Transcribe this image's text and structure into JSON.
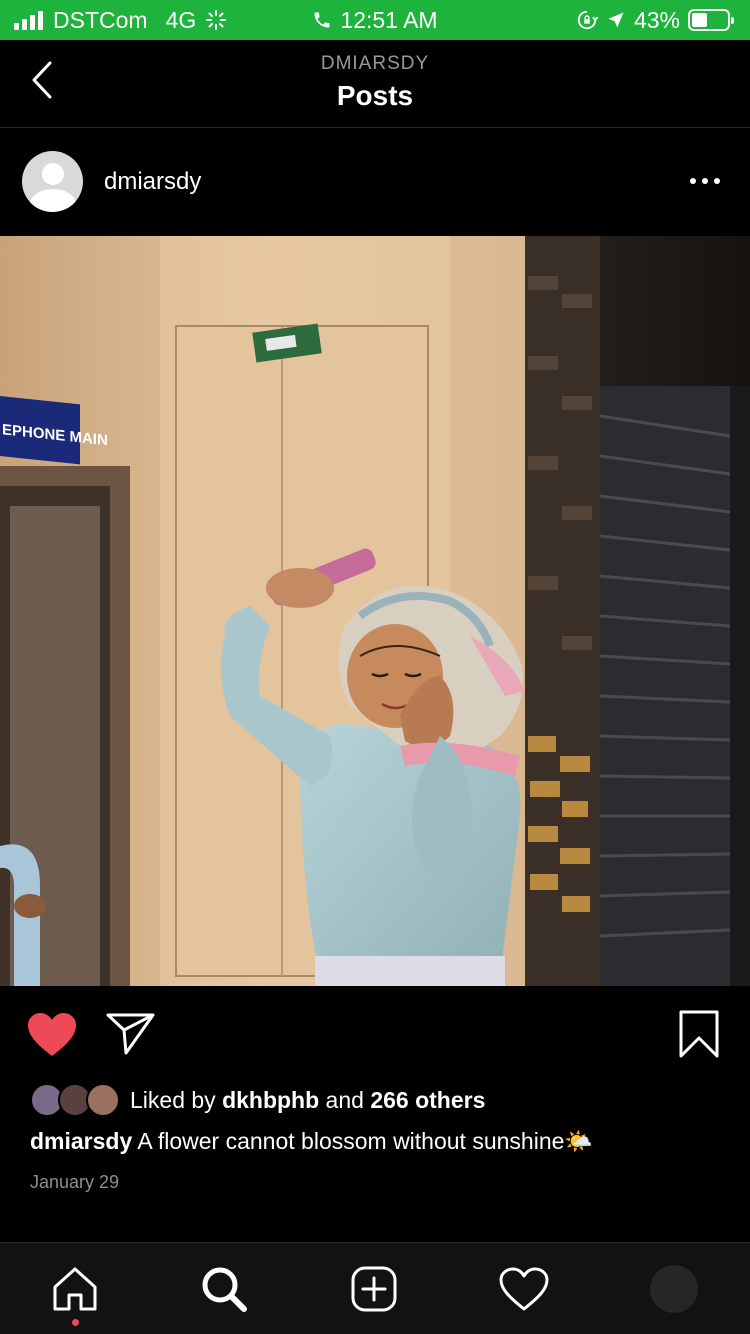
{
  "status_bar": {
    "carrier": "DSTCom",
    "network": "4G",
    "time": "12:51 AM",
    "battery": "43%",
    "battery_level": 0.43,
    "icons": [
      "signal-icon",
      "loading-icon",
      "phone-call-icon",
      "rotation-lock-icon",
      "location-icon",
      "battery-icon"
    ]
  },
  "header": {
    "subtitle": "DMIARSDY",
    "title": "Posts"
  },
  "post": {
    "username": "dmiarsdy",
    "liked": true,
    "liked_by_prefix": "Liked by ",
    "liked_by_user": "dkhbphb",
    "liked_by_and": " and ",
    "liked_by_others": "266 others",
    "caption_user": "dmiarsdy",
    "caption_text": " A flower cannot blossom without sunshine🌤️",
    "date": "January 29",
    "sign_text": "EPHONE MAIN"
  },
  "colors": {
    "status_bar": "#1db33c",
    "heart": "#ed4956",
    "background": "#000000"
  },
  "tabbar": {
    "items": [
      "home-icon",
      "search-icon",
      "new-post-icon",
      "activity-icon",
      "profile-icon"
    ],
    "active": "home-icon"
  }
}
